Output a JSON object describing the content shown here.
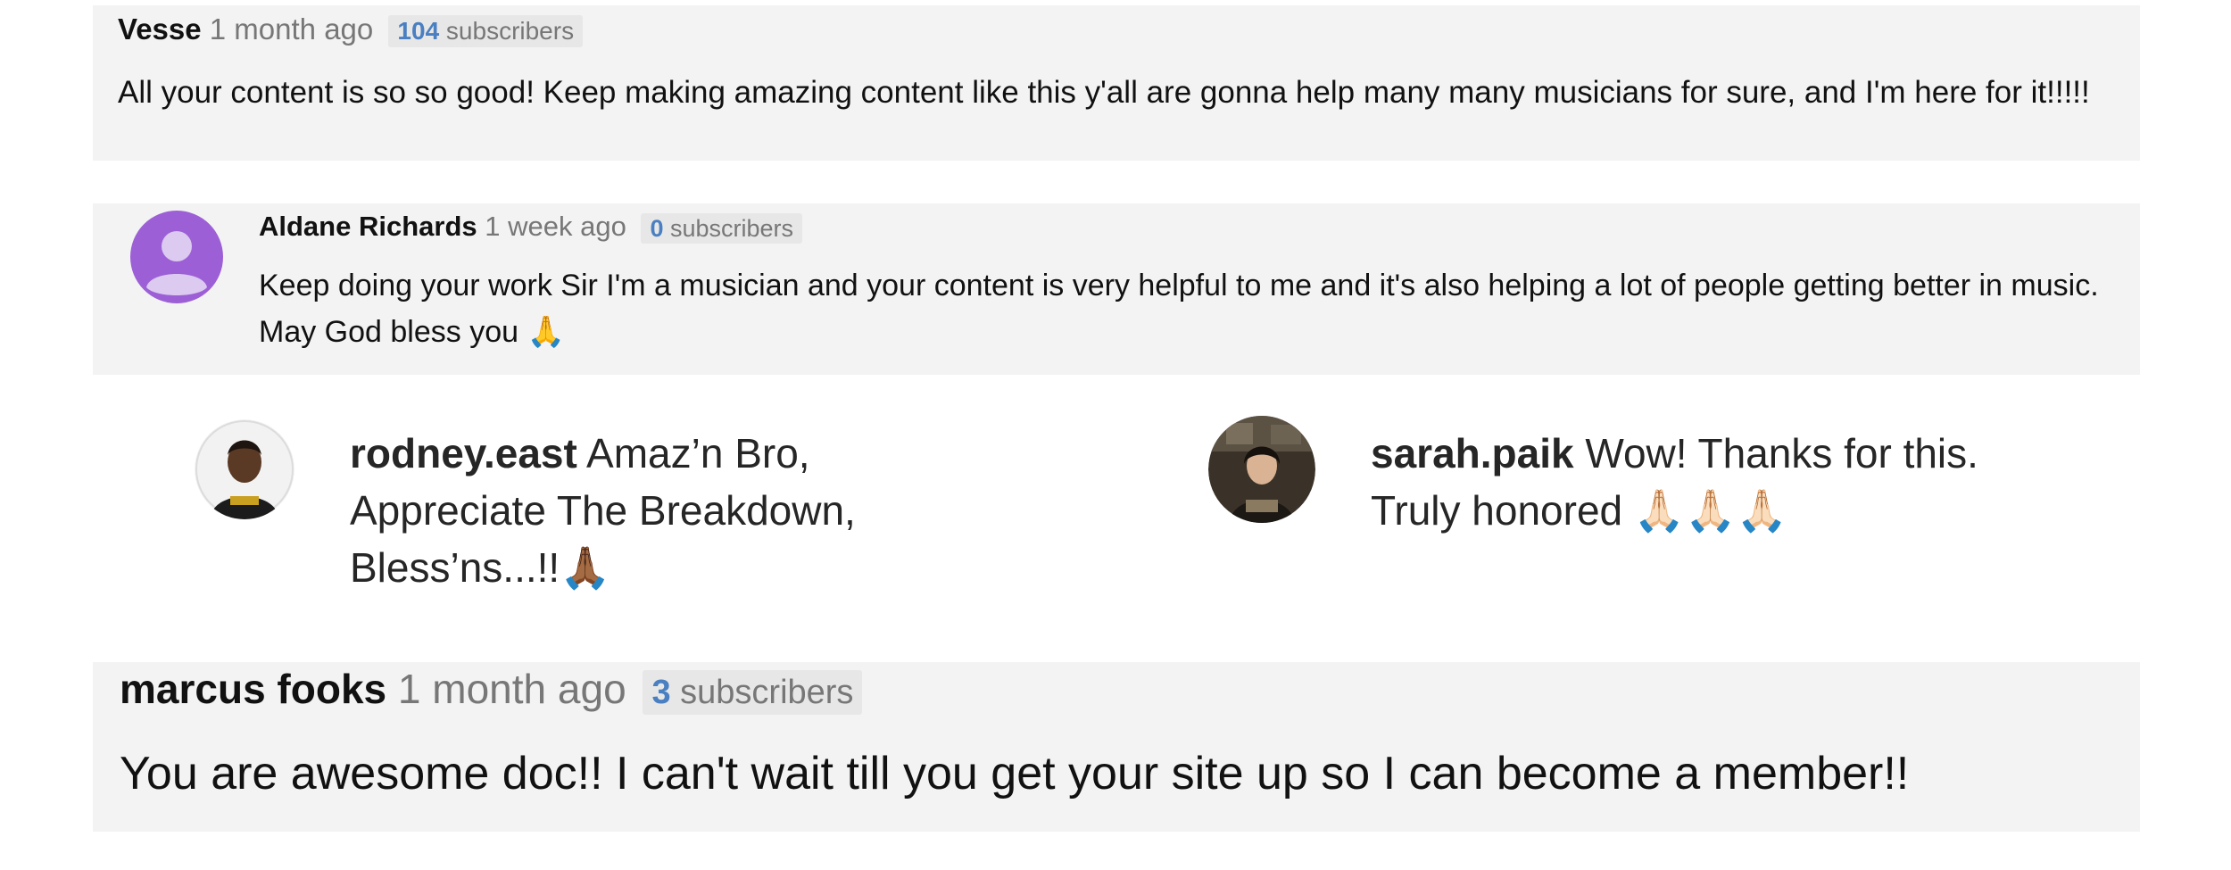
{
  "comments": [
    {
      "author": "Vesse",
      "time": "1 month ago",
      "subscriber_count": "104",
      "subscriber_label": "subscribers",
      "text": "All your content is so so good! Keep making amazing content like this y'all are gonna help many many musicians for sure, and I'm here for it!!!!!"
    },
    {
      "author": "Aldane Richards",
      "time": "1 week ago",
      "subscriber_count": "0",
      "subscriber_label": "subscribers",
      "text": "Keep doing your work Sir I'm a musician and your content is very helpful to me and it's also helping a lot of people getting better in music. May God bless you 🙏",
      "avatar_color": "#9c5fd6"
    },
    {
      "author": "marcus fooks",
      "time": "1 month ago",
      "subscriber_count": "3",
      "subscriber_label": "subscribers",
      "text": "You are awesome doc!! I can't wait till you get your site up so I can become a member!!"
    }
  ],
  "instagram_comments": [
    {
      "handle": "rodney.east",
      "text": "Amaz’n Bro, Appreciate The Breakdown, Bless’ns...!!🙏🏾"
    },
    {
      "handle": "sarah.paik",
      "text": "Wow! Thanks for this. Truly honored 🙏🏻🙏🏻🙏🏻"
    }
  ],
  "colors": {
    "panel_bg": "#f3f3f3",
    "subscriber_count": "#4a7fc1",
    "timestamp": "#777777"
  }
}
